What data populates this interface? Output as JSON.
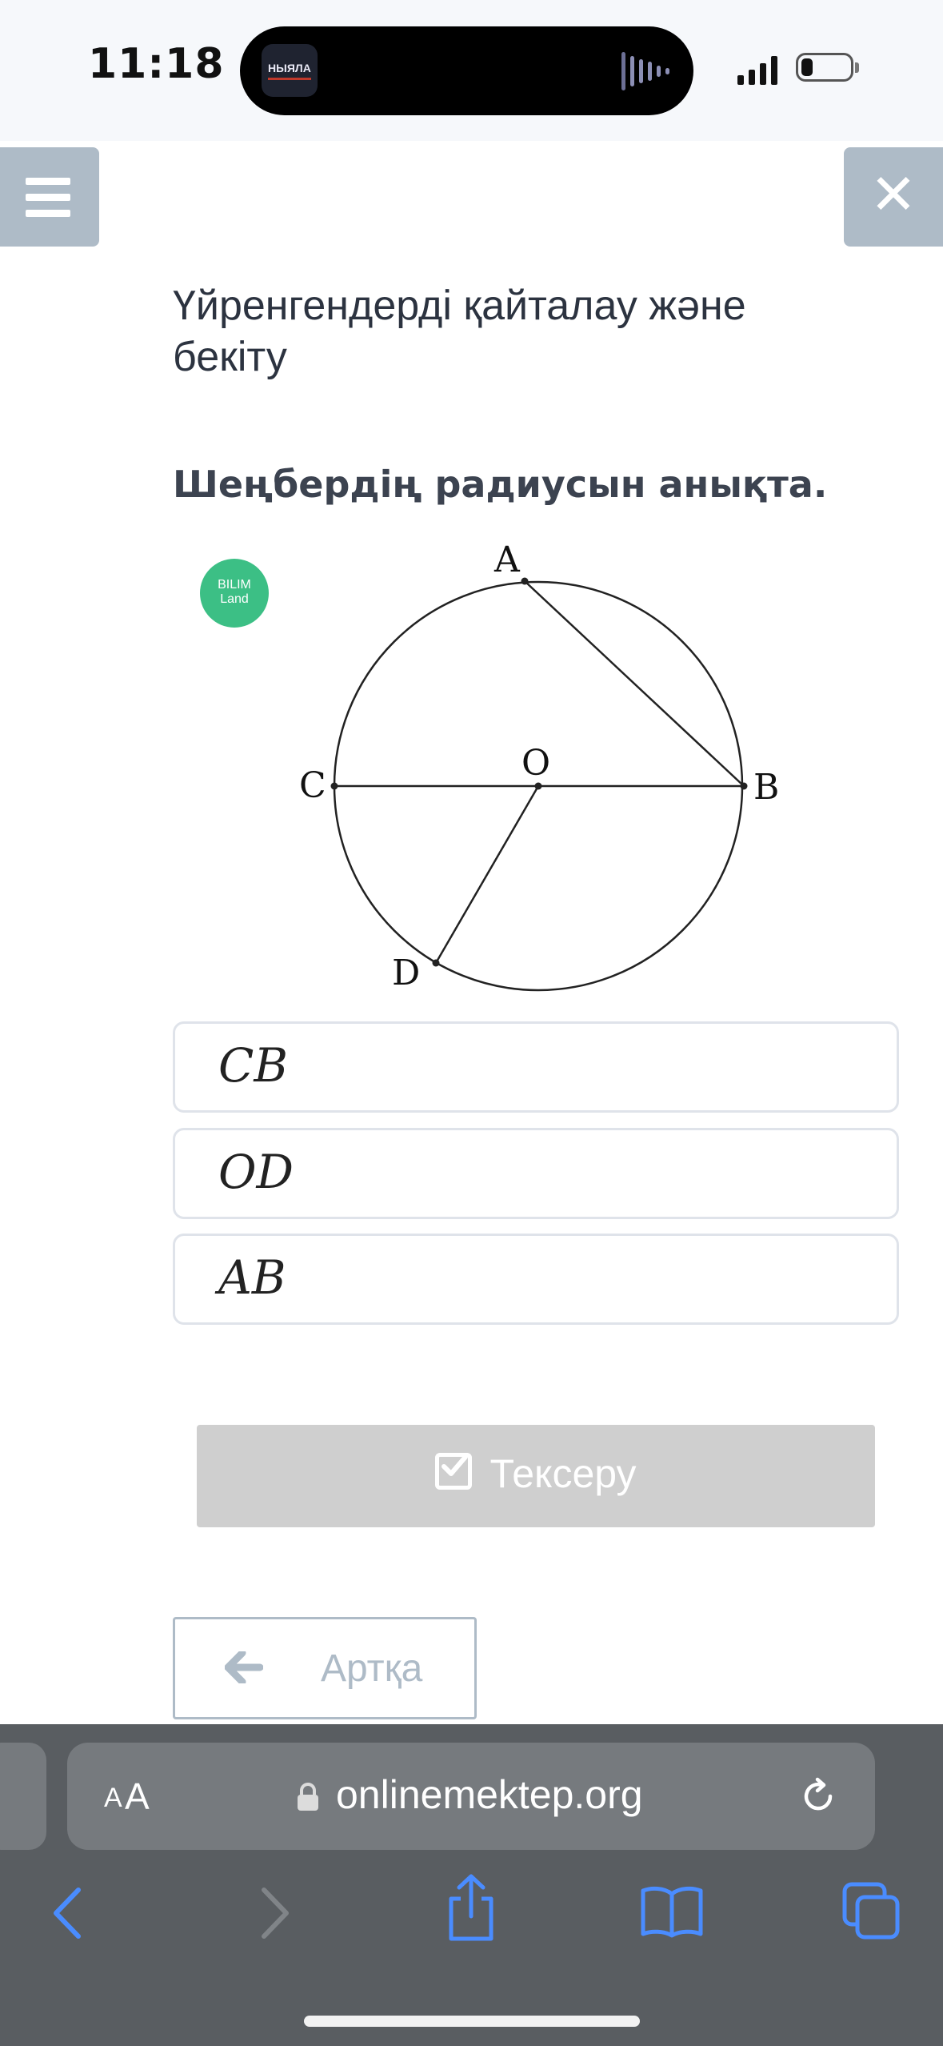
{
  "status_bar": {
    "time": "11:18",
    "live_activity_app": "НЫЯЛА"
  },
  "page": {
    "lesson_title": "Үйренгендерді қайталау және бекіту",
    "question": "Шеңбердің радиусын анықта."
  },
  "logo": {
    "line1": "BILIM",
    "line2": "Land"
  },
  "diagram": {
    "labels": {
      "A": "A",
      "B": "B",
      "C": "C",
      "D": "D",
      "O": "O"
    }
  },
  "options": [
    {
      "label": "CB"
    },
    {
      "label": "OD"
    },
    {
      "label": "AB"
    }
  ],
  "buttons": {
    "check": "Тексеру",
    "back": "Артқа"
  },
  "browser": {
    "aa_small": "A",
    "aa_big": "A",
    "url": "onlinemektep.org"
  },
  "colors": {
    "accent_gray": "#aebbc7",
    "logo_green": "#3cbf85",
    "check_disabled": "#cfcfcf",
    "browser_bar": "#595d61",
    "browser_blue": "#4a8cff"
  },
  "icons": [
    "menu-icon",
    "close-icon",
    "check-icon",
    "arrow-left-icon",
    "lock-icon",
    "reload-icon",
    "back-icon",
    "forward-icon",
    "share-icon",
    "bookmarks-icon",
    "tabs-icon"
  ]
}
